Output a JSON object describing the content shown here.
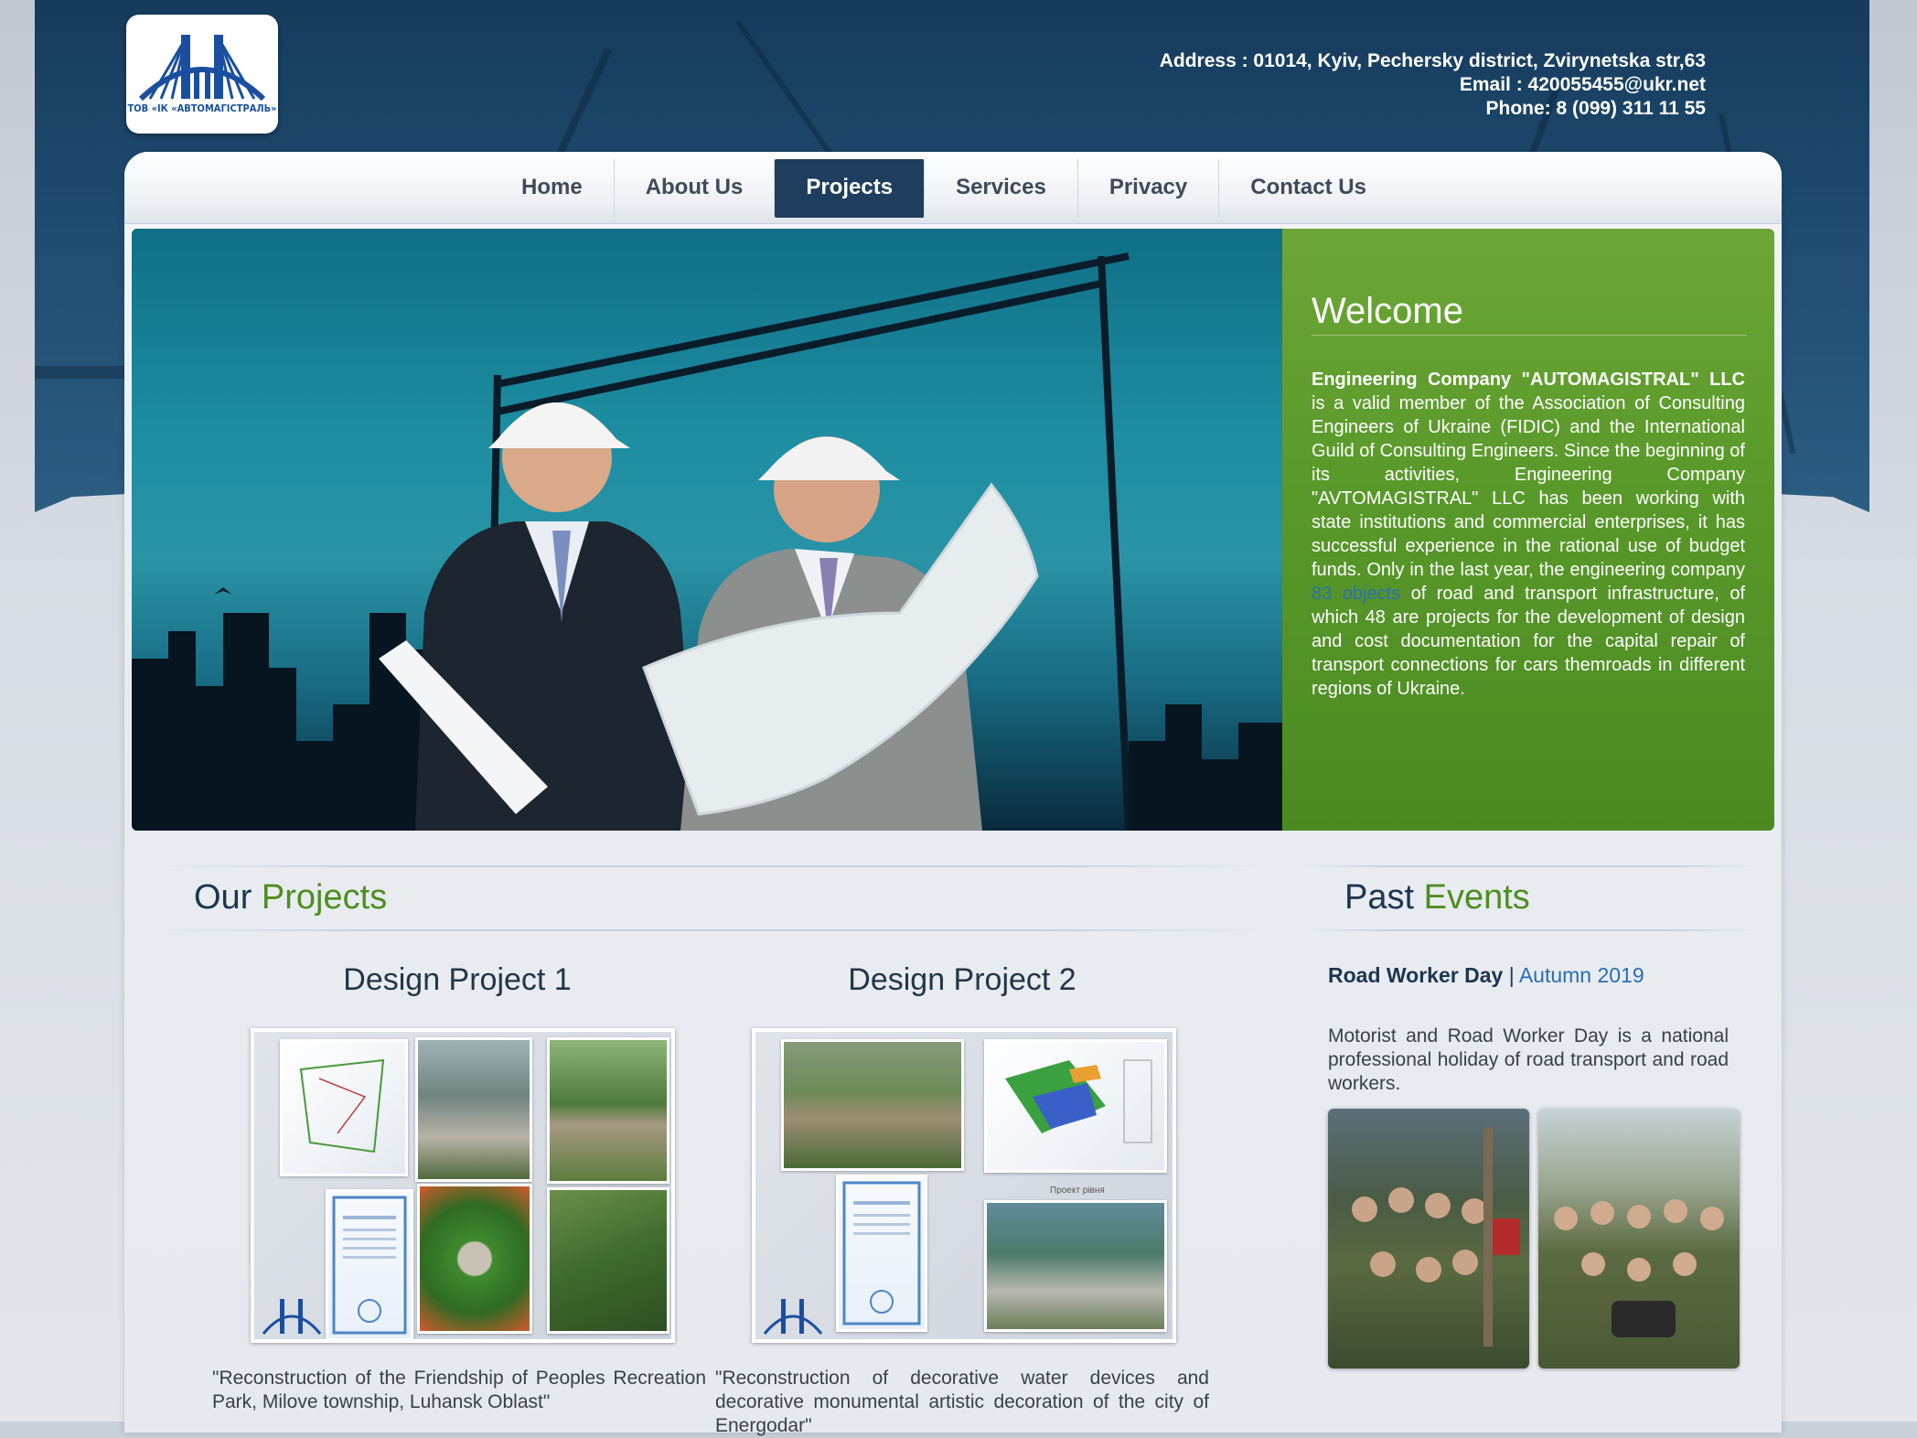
{
  "header": {
    "logo_text": "ТОВ «ІК «АВТОМАГІСТРАЛЬ»",
    "address": "Address : 01014, Kyiv, Pechersky district, Zvirynetska str,63",
    "email": "Email : 420055455@ukr.net",
    "phone": "Phone: 8 (099) 311 11 55"
  },
  "nav": {
    "items": [
      {
        "label": "Home"
      },
      {
        "label": "About Us"
      },
      {
        "label": "Projects"
      },
      {
        "label": "Services"
      },
      {
        "label": "Privacy"
      },
      {
        "label": "Contact Us"
      }
    ],
    "active": "Projects"
  },
  "welcome": {
    "title": "Welcome",
    "company_bold": "Engineering Company \"AUTOMAGISTRAL\" LLC",
    "text_part1": " is a valid member of the Association of Consulting Engineers of Ukraine (FIDIC) and the International Guild of Consulting Engineers. Since the beginning of its activities, Engineering Company \"AVTOMAGISTRAL\" LLC has been working with state institutions and commercial enterprises, it has successful experience in the rational use of budget funds. Only in the last year, the engineering company ",
    "link_text": "83 objects",
    "text_part2": " of road and transport infrastructure, of which 48 are projects for the development of design and cost documentation for the capital repair of transport connections for cars themroads in different regions of Ukraine."
  },
  "projects": {
    "title_main": "Our",
    "title_accent": "Projects",
    "items": [
      {
        "title": "Design Project 1",
        "caption": "\"Reconstruction of the Friendship of Peoples Recreation Park, Milove township, Luhansk Oblast\""
      },
      {
        "title": "Design Project 2",
        "caption": "\"Reconstruction of decorative water devices and decorative monumental artistic decoration of the city of Energodar\""
      }
    ],
    "plan_label": "Проект рівня"
  },
  "events": {
    "title_main": "Past",
    "title_accent": "Events",
    "event_name": "Road Worker Day",
    "separator": " | ",
    "event_season": "Autumn 2019",
    "event_text": "Motorist and Road Worker Day is a national professional holiday of road transport and road workers."
  },
  "colors": {
    "header_bg": "#1e4a6e",
    "nav_active": "#1f3e5d",
    "welcome_green": "#5a9a2b",
    "accent_green": "#4e8e1f",
    "link_blue": "#2a6cb5"
  }
}
